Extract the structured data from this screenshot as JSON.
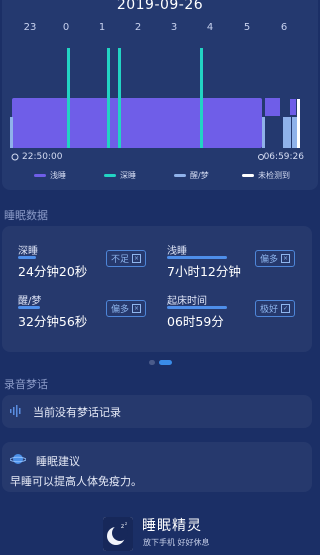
{
  "chart": {
    "date": "2019-09-26",
    "hour_ticks": [
      "23",
      "0",
      "1",
      "2",
      "3",
      "4",
      "5",
      "6"
    ],
    "start_time": "22:50:00",
    "end_time": "06:59:26",
    "colors": {
      "light_sleep": "#6f5ee8",
      "deep_sleep": "#22d4c3",
      "awake": "#8fb2ea",
      "not_detected": "#ffffff"
    },
    "legend": [
      {
        "label": "浅睡",
        "color": "#6f5ee8"
      },
      {
        "label": "深睡",
        "color": "#22d4c3"
      },
      {
        "label": "醒/梦",
        "color": "#8fb2ea"
      },
      {
        "label": "未检测到",
        "color": "#ffffff"
      }
    ]
  },
  "sleep_data": {
    "title": "睡眠数据",
    "metrics": [
      {
        "label": "深睡",
        "value": "24分钟20秒",
        "badge": "不足"
      },
      {
        "label": "浅睡",
        "value": "7小时12分钟",
        "badge": "偏多"
      },
      {
        "label": "醒/梦",
        "value": "32分钟56秒",
        "badge": "偏多"
      },
      {
        "label": "起床时间",
        "value": "06时59分",
        "badge": "极好"
      }
    ]
  },
  "pager": {
    "count": 2,
    "active": 1
  },
  "recording": {
    "title": "录音梦话",
    "empty_text": "当前没有梦话记录"
  },
  "advice": {
    "title": "睡眠建议",
    "text": "早睡可以提高人体免疫力。"
  },
  "app": {
    "name": "睡眠精灵",
    "slogan": "放下手机 好好休息"
  }
}
